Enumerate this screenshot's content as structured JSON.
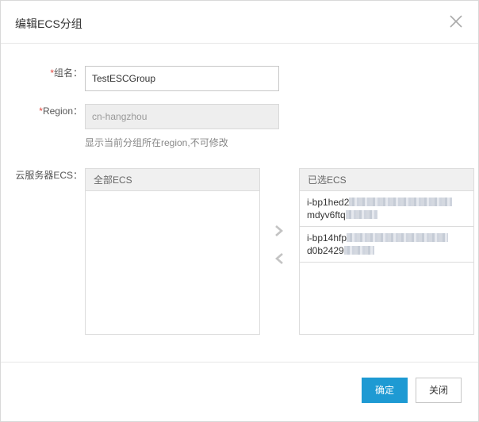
{
  "dialog": {
    "title": "编辑ECS分组",
    "close_icon": "close-icon"
  },
  "form": {
    "group_name": {
      "required_mark": "*",
      "label": "组名：",
      "value": "TestESCGroup"
    },
    "region": {
      "required_mark": "*",
      "label": "Region：",
      "value": "cn-hangzhou",
      "hint": "显示当前分组所在region,不可修改"
    },
    "ecs": {
      "label": "云服务器ECS：",
      "available": {
        "header": "全部ECS",
        "items": []
      },
      "selected": {
        "header": "已选ECS",
        "items": [
          {
            "line1": "i-bp1hed2",
            "line2": "mdyv6ftq"
          },
          {
            "line1": "i-bp14hfp",
            "line2": "d0b2429"
          }
        ]
      },
      "move_right_icon": "chevron-right-icon",
      "move_left_icon": "chevron-left-icon"
    }
  },
  "footer": {
    "confirm_label": "确定",
    "close_label": "关闭"
  },
  "colors": {
    "primary": "#1e9ad3",
    "required": "#e0463d",
    "disabled_bg": "#eeeeee"
  }
}
